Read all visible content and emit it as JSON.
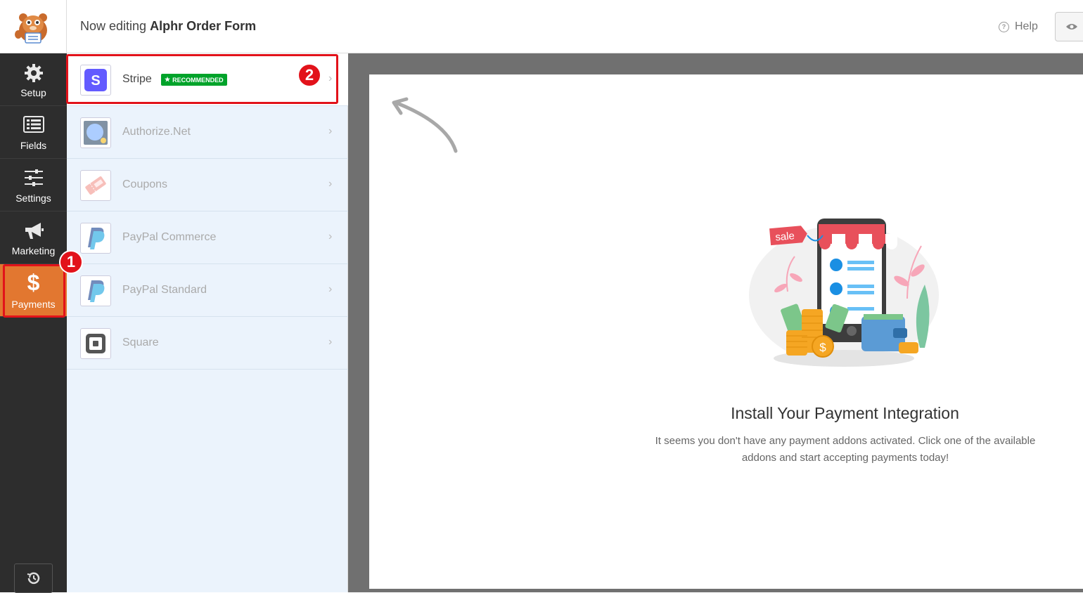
{
  "header": {
    "editing_prefix": "Now editing",
    "form_name": "Alphr Order Form",
    "help_label": "Help",
    "preview_icon": "eye-icon"
  },
  "nav": {
    "items": [
      {
        "label": "Setup",
        "icon": "gear-icon"
      },
      {
        "label": "Fields",
        "icon": "fields-icon"
      },
      {
        "label": "Settings",
        "icon": "sliders-icon"
      },
      {
        "label": "Marketing",
        "icon": "megaphone-icon"
      },
      {
        "label": "Payments",
        "icon": "dollar-icon"
      }
    ],
    "active": "Payments",
    "active_color": "#e27730",
    "history_icon": "history-icon"
  },
  "annotations": {
    "step1": "1",
    "step2": "2",
    "highlight_color": "#e2121a"
  },
  "payments": {
    "items": [
      {
        "name": "Stripe",
        "icon": "stripe-icon",
        "badge": "RECOMMENDED"
      },
      {
        "name": "Authorize.Net",
        "icon": "authorize-net-icon"
      },
      {
        "name": "Coupons",
        "icon": "coupon-icon"
      },
      {
        "name": "PayPal Commerce",
        "icon": "paypal-icon"
      },
      {
        "name": "PayPal Standard",
        "icon": "paypal-icon"
      },
      {
        "name": "Square",
        "icon": "square-icon"
      }
    ],
    "badge_color": "#00a32a"
  },
  "main": {
    "title": "Install Your Payment Integration",
    "description": "It seems you don't have any payment addons activated. Click one of the available addons and start accepting payments today!",
    "illustration_sale_tag": "sale"
  }
}
